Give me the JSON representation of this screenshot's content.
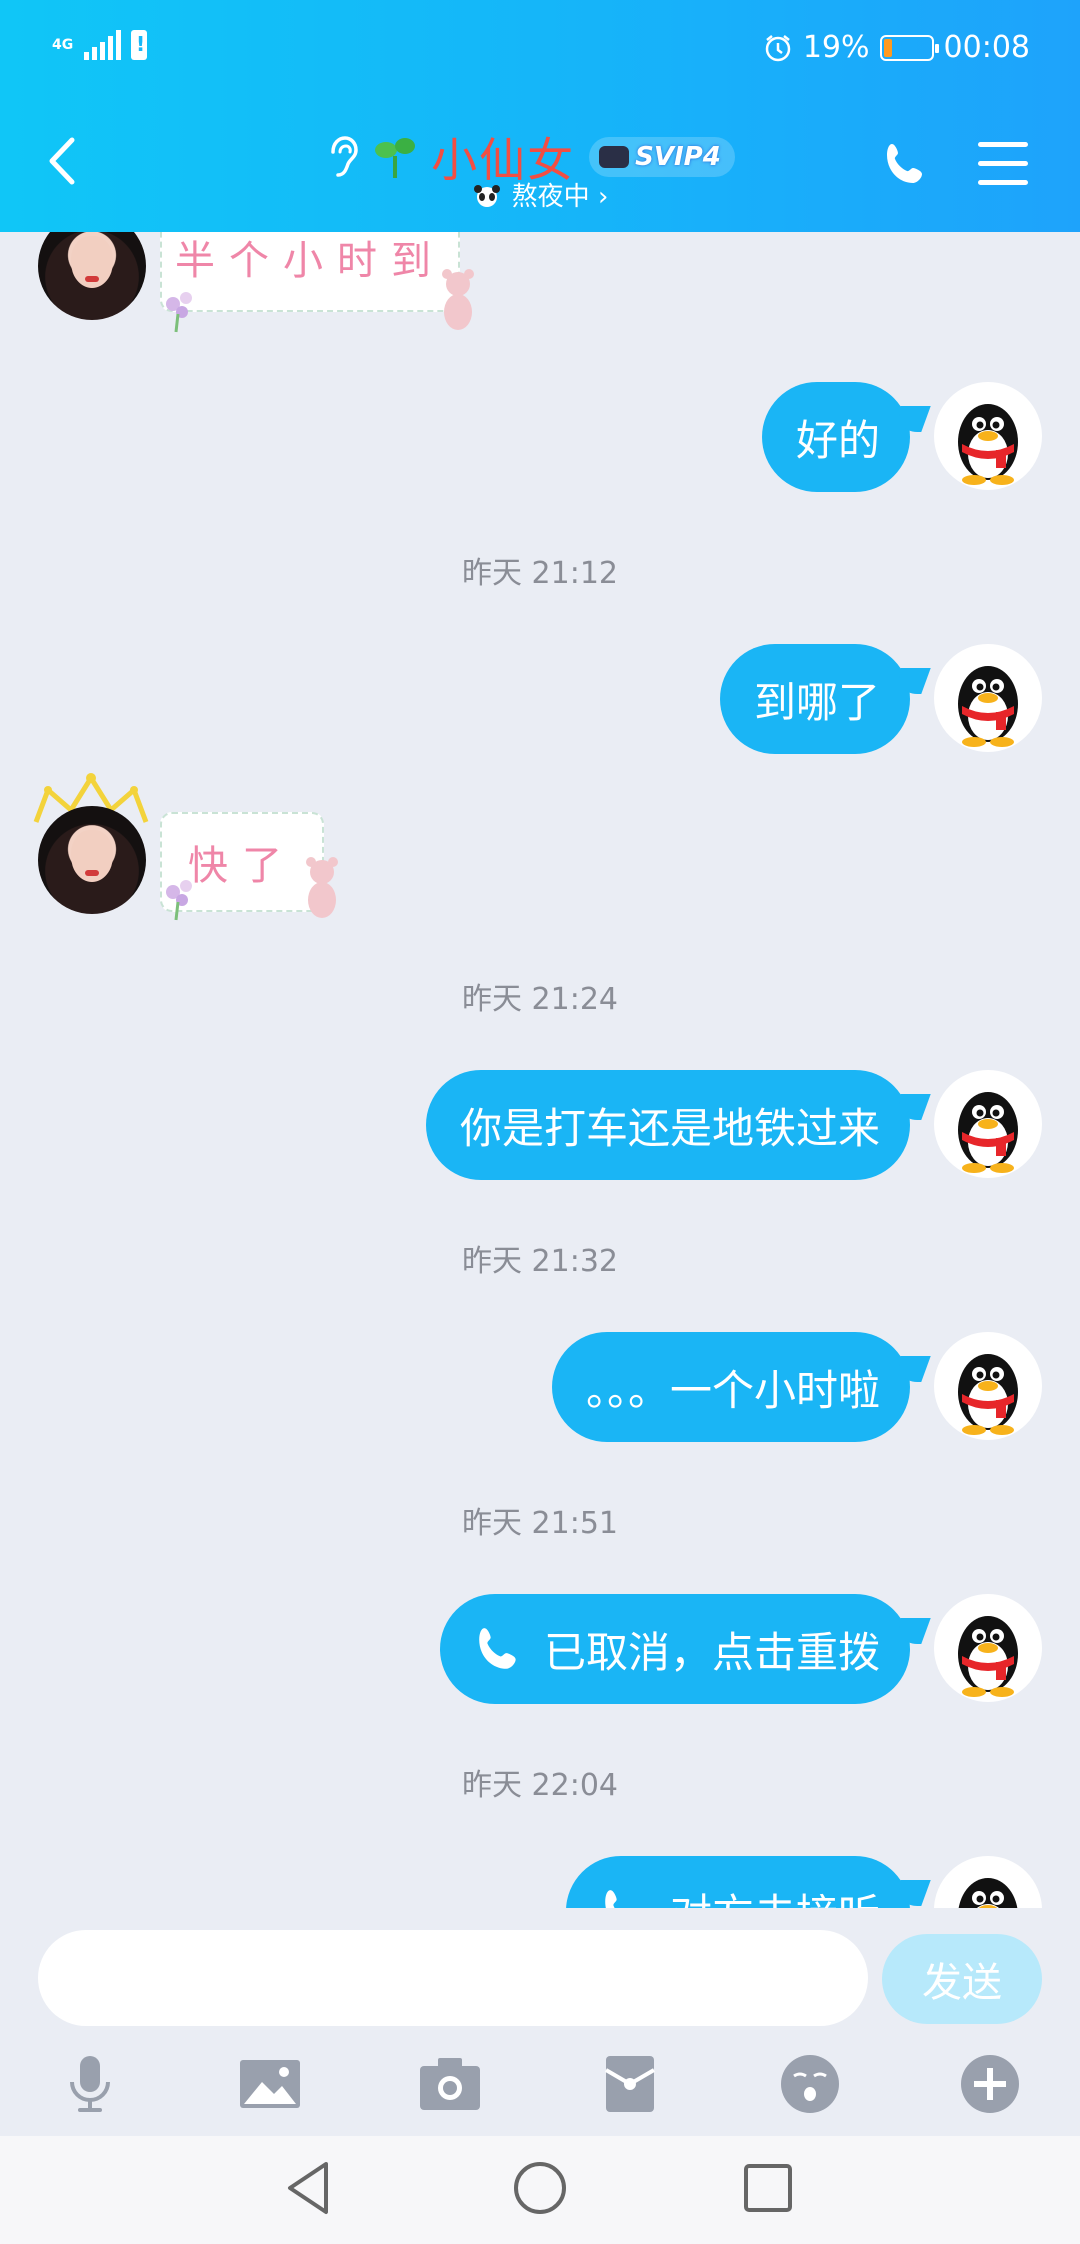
{
  "status_bar": {
    "network": "4G",
    "battery_percent": "19%",
    "time": "00:08",
    "battery_level": 0.19
  },
  "header": {
    "title": "小仙女",
    "vip_badge": "SVIP4",
    "status": "熬夜中",
    "status_chevron": "›"
  },
  "messages": [
    {
      "type": "sticker",
      "from": "her",
      "text": "半个小时到"
    },
    {
      "type": "text",
      "from": "me",
      "text": "好的"
    },
    {
      "type": "timestamp",
      "text": "昨天 21:12"
    },
    {
      "type": "text",
      "from": "me",
      "text": "到哪了"
    },
    {
      "type": "sticker",
      "from": "her",
      "text": "快了"
    },
    {
      "type": "timestamp",
      "text": "昨天 21:24"
    },
    {
      "type": "text",
      "from": "me",
      "text": "你是打车还是地铁过来"
    },
    {
      "type": "timestamp",
      "text": "昨天 21:32"
    },
    {
      "type": "text",
      "from": "me",
      "text": "。。。一个小时啦"
    },
    {
      "type": "timestamp",
      "text": "昨天 21:51"
    },
    {
      "type": "call",
      "from": "me",
      "text": "已取消，点击重拨"
    },
    {
      "type": "timestamp",
      "text": "昨天 22:04"
    },
    {
      "type": "call",
      "from": "me",
      "text": "对方未接听"
    }
  ],
  "input": {
    "value": "",
    "send_label": "发送"
  },
  "toolbar": {
    "icons": [
      "microphone-icon",
      "image-icon",
      "camera-icon",
      "red-packet-icon",
      "emoji-icon",
      "plus-icon"
    ]
  },
  "colors": {
    "header_gradient_start": "#10c6f7",
    "header_gradient_end": "#1ea3fb",
    "bubble": "#1ab5f5",
    "title": "#f24e43",
    "send_disabled": "#b7e9fb"
  }
}
